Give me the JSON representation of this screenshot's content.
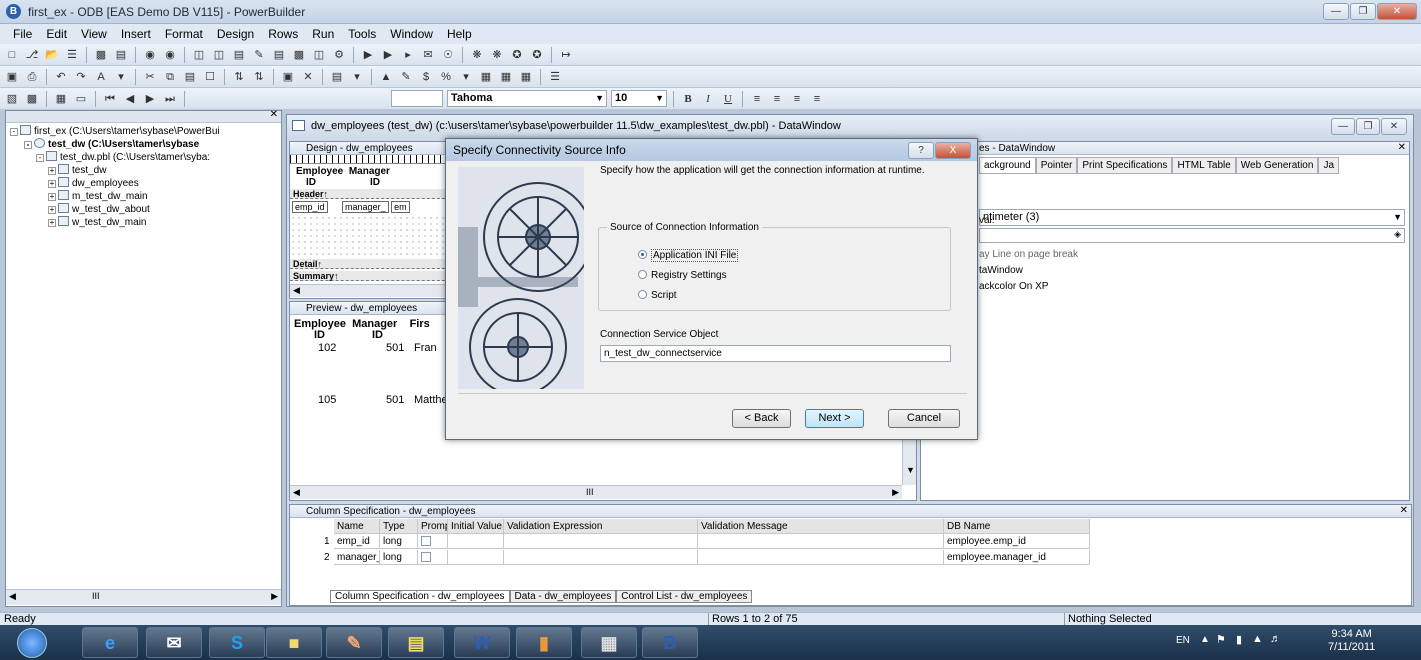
{
  "window": {
    "title": "first_ex - ODB [EAS Demo DB V115] - PowerBuilder",
    "app_icon": "B"
  },
  "menu": [
    "File",
    "Edit",
    "View",
    "Insert",
    "Format",
    "Design",
    "Rows",
    "Run",
    "Tools",
    "Window",
    "Help"
  ],
  "toolbar3": {
    "font_name": "Tahoma",
    "font_size": "10",
    "bold": "B",
    "italic": "I",
    "underline": "U",
    "currency": "$",
    "percent": "%"
  },
  "tree": {
    "items": [
      {
        "label": "first_ex (C:\\Users\\tamer\\sybase\\PowerBui",
        "depth": 0,
        "bold": false
      },
      {
        "label": "test_dw (C:\\Users\\tamer\\sybase",
        "depth": 1,
        "bold": true
      },
      {
        "label": "test_dw.pbl (C:\\Users\\tamer\\syba:",
        "depth": 2,
        "bold": false
      },
      {
        "label": "test_dw",
        "depth": 3,
        "bold": false
      },
      {
        "label": "dw_employees",
        "depth": 3,
        "bold": false
      },
      {
        "label": "m_test_dw_main",
        "depth": 3,
        "bold": false
      },
      {
        "label": "w_test_dw_about",
        "depth": 3,
        "bold": false
      },
      {
        "label": "w_test_dw_main",
        "depth": 3,
        "bold": false
      }
    ],
    "scroll_label": "III"
  },
  "dw_window": {
    "title": "dw_employees  (test_dw) (c:\\users\\tamer\\sybase\\powerbuilder 11.5\\dw_examples\\test_dw.pbl) - DataWindow"
  },
  "design": {
    "title": "Design - dw_employees",
    "col1": "Employee",
    "col1b": "ID",
    "col2": "Manager",
    "col2b": "ID",
    "header_band": "Header↑",
    "detail_fields": [
      "emp_id",
      "manager_",
      "em"
    ],
    "detail_band": "Detail↑",
    "summary_band": "Summary↑"
  },
  "preview": {
    "title": "Preview - dw_employees",
    "headers": [
      "Employee",
      "Manager",
      "Firs"
    ],
    "headers2": [
      "ID",
      "ID"
    ],
    "rows": [
      [
        "102",
        "501",
        "Fran"
      ],
      [
        "105",
        "501",
        "Matthe"
      ]
    ],
    "scroll_label": "III"
  },
  "properties": {
    "title": "es - DataWindow",
    "tabs": [
      "ackground",
      "Pointer",
      "Print Specifications",
      "HTML Table",
      "Web Generation",
      "Ja"
    ],
    "units": "ntimeter (3)",
    "interval_label": "val:",
    "options": [
      "ay Line on page break",
      "taWindow",
      "ackcolor On XP"
    ]
  },
  "dialog": {
    "title": "Specify Connectivity Source Info",
    "help_btn": "?",
    "close_btn": "X",
    "description": "Specify how the application will get the connection information at runtime.",
    "group_label": "Source of Connection Information",
    "options": [
      "Application INI File",
      "Registry Settings",
      "Script"
    ],
    "selected": 0,
    "cso_label": "Connection Service Object",
    "cso_value": "n_test_dw_connectservice",
    "back": "< Back",
    "next": "Next >",
    "cancel": "Cancel"
  },
  "colspec": {
    "title": "Column Specification - dw_employees",
    "columns": [
      "Name",
      "Type",
      "Prompt",
      "Initial Value",
      "Validation Expression",
      "Validation Message",
      "DB Name"
    ],
    "rows": [
      {
        "num": "1",
        "name": "emp_id",
        "type": "long",
        "db": "employee.emp_id"
      },
      {
        "num": "2",
        "name": "manager_id",
        "type": "long",
        "db": "employee.manager_id"
      }
    ],
    "tabs": [
      "Column Specification - dw_employees",
      "Data - dw_employees",
      "Control List - dw_employees"
    ]
  },
  "statusbar": {
    "ready": "Ready",
    "rows": "Rows 1 to 2 of 75",
    "selection": "Nothing Selected"
  },
  "taskbar": {
    "lang": "EN",
    "time": "9:34 AM",
    "date": "7/11/2011",
    "items": [
      "ie",
      "mail",
      "skype",
      "folder",
      "paint",
      "explorer",
      "word",
      "library",
      "calculator",
      "powerbuilder"
    ]
  }
}
